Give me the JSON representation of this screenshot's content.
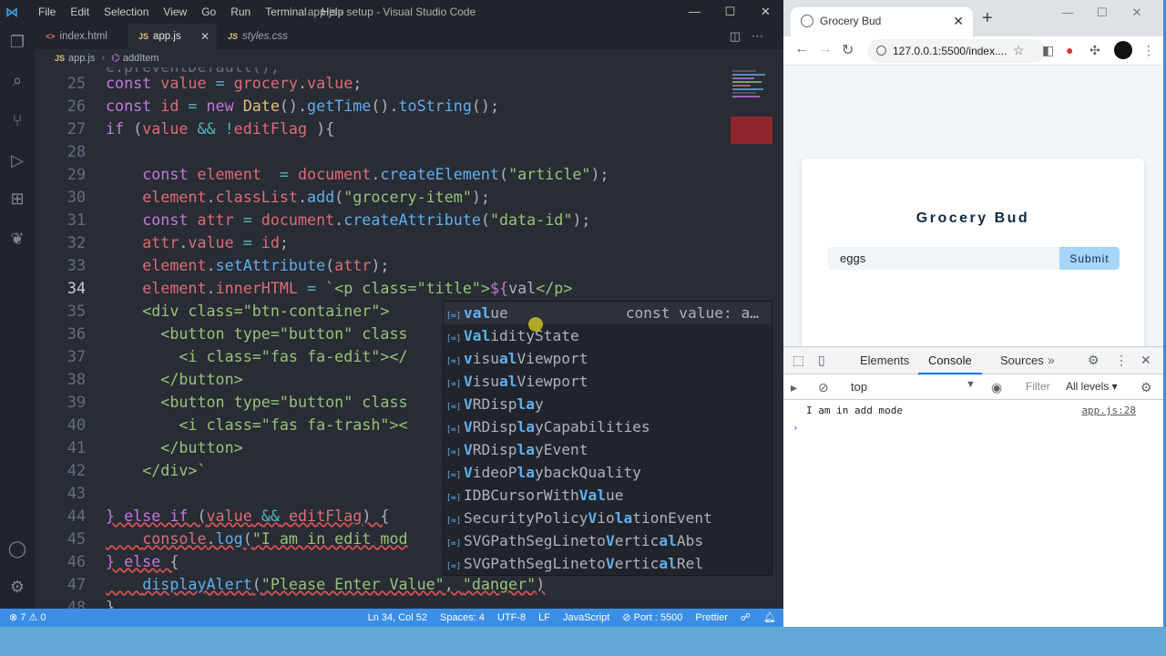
{
  "vscode": {
    "menu": [
      "File",
      "Edit",
      "Selection",
      "View",
      "Go",
      "Run",
      "Terminal",
      "Help"
    ],
    "window_title": "app.js - setup - Visual Studio Code",
    "tabs": [
      {
        "icon": "<>",
        "label": "index.html"
      },
      {
        "icon": "JS",
        "label": "app.js"
      },
      {
        "icon": "JS",
        "label": "styles.css"
      }
    ],
    "breadcrumb": {
      "file": "app.js",
      "symbol": "addItem"
    },
    "line_numbers": [
      "25",
      "26",
      "27",
      "28",
      "29",
      "30",
      "31",
      "32",
      "33",
      "34",
      "35",
      "36",
      "37",
      "38",
      "39",
      "40",
      "41",
      "42",
      "43",
      "44",
      "45",
      "46",
      "47",
      "48"
    ],
    "suggestions": [
      {
        "pre": "",
        "match": "val",
        "post": "ue",
        "detail": "const value: a…"
      },
      {
        "pre": "",
        "match": "Val",
        "post": "idityState",
        "detail": ""
      },
      {
        "pre": "",
        "match": "v",
        "post": "isu",
        "match2": "al",
        "post2": "Viewport",
        "detail": ""
      },
      {
        "pre": "",
        "match": "V",
        "post": "isu",
        "match2": "al",
        "post2": "Viewport",
        "detail": ""
      },
      {
        "pre": "",
        "match": "V",
        "post": "RDisp",
        "match2": "la",
        "post2": "y",
        "detail": ""
      },
      {
        "pre": "",
        "match": "V",
        "post": "RDisp",
        "match2": "la",
        "post2": "yCapabilities",
        "detail": ""
      },
      {
        "pre": "",
        "match": "V",
        "post": "RDisp",
        "match2": "la",
        "post2": "yEvent",
        "detail": ""
      },
      {
        "pre": "",
        "match": "V",
        "post": "ideoP",
        "match2": "la",
        "post2": "ybackQuality",
        "detail": ""
      },
      {
        "pre": "IDBCursorWith",
        "match": "Val",
        "post": "ue",
        "detail": ""
      },
      {
        "pre": "SecurityPolicy",
        "match": "V",
        "post": "io",
        "match2": "la",
        "post2": "tionEvent",
        "detail": ""
      },
      {
        "pre": "SVGPathSegLineto",
        "match": "V",
        "post": "ertic",
        "match2": "al",
        "post2": "Abs",
        "detail": ""
      },
      {
        "pre": "SVGPathSegLineto",
        "match": "V",
        "post": "ertic",
        "match2": "al",
        "post2": "Rel",
        "detail": ""
      }
    ],
    "status": {
      "problems": "⊗ 7 ⚠ 0",
      "items": [
        "Ln 34, Col 52",
        "Spaces: 4",
        "UTF-8",
        "LF",
        "JavaScript",
        "⊘ Port : 5500",
        "Prettier"
      ]
    }
  },
  "browser": {
    "tab_title": "Grocery Bud",
    "url": "127.0.0.1:5500/index....",
    "app_title": "Grocery Bud",
    "input_value": "eggs",
    "submit_label": "Submit",
    "devtools": {
      "tabs": [
        "Elements",
        "Console",
        "Sources"
      ],
      "context": "top",
      "filter_placeholder": "Filter",
      "levels": "All levels ▾",
      "log": {
        "message": "I am in add mode",
        "source": "app.js:28"
      }
    }
  },
  "colors": {
    "status_bar": "#3a8ee6",
    "editor_bg": "#282c34",
    "submit_bg": "#a5d5f8",
    "taskbar": "#62a9d9"
  }
}
